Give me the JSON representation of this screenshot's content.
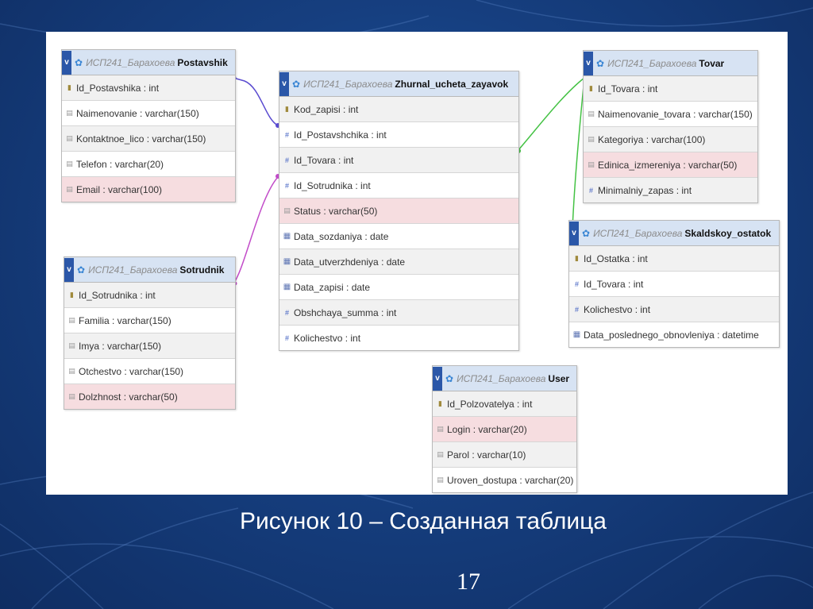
{
  "tables": [
    {
      "db": "ИСП241_Барахоева",
      "name": "Postavshik",
      "fields": [
        {
          "label": "Id_Postavshika : int",
          "icon": "pk"
        },
        {
          "label": "Naimenovanie : varchar(150)",
          "icon": "txt"
        },
        {
          "label": "Kontaktnoe_lico : varchar(150)",
          "icon": "txt"
        },
        {
          "label": "Telefon : varchar(20)",
          "icon": "txt"
        },
        {
          "label": "Email : varchar(100)",
          "icon": "txt"
        }
      ]
    },
    {
      "db": "ИСП241_Барахоева",
      "name": "Zhurnal_ucheta_zayavok",
      "fields": [
        {
          "label": "Kod_zapisi : int",
          "icon": "pk"
        },
        {
          "label": "Id_Postavshchika : int",
          "icon": "int"
        },
        {
          "label": "Id_Tovara : int",
          "icon": "int"
        },
        {
          "label": "Id_Sotrudnika : int",
          "icon": "int"
        },
        {
          "label": "Status : varchar(50)",
          "icon": "txt"
        },
        {
          "label": "Data_sozdaniya : date",
          "icon": "date"
        },
        {
          "label": "Data_utverzhdeniya : date",
          "icon": "date"
        },
        {
          "label": "Data_zapisi : date",
          "icon": "date"
        },
        {
          "label": "Obshchaya_summa : int",
          "icon": "int"
        },
        {
          "label": "Kolichestvo : int",
          "icon": "int"
        }
      ]
    },
    {
      "db": "ИСП241_Барахоева",
      "name": "Tovar",
      "fields": [
        {
          "label": "Id_Tovara : int",
          "icon": "pk"
        },
        {
          "label": "Naimenovanie_tovara : varchar(150)",
          "icon": "txt"
        },
        {
          "label": "Kategoriya : varchar(100)",
          "icon": "txt"
        },
        {
          "label": "Edinica_izmereniya : varchar(50)",
          "icon": "txt"
        },
        {
          "label": "Minimalniy_zapas : int",
          "icon": "int"
        }
      ]
    },
    {
      "db": "ИСП241_Барахоева",
      "name": "Sotrudnik",
      "fields": [
        {
          "label": "Id_Sotrudnika : int",
          "icon": "pk"
        },
        {
          "label": "Familia : varchar(150)",
          "icon": "txt"
        },
        {
          "label": "Imya : varchar(150)",
          "icon": "txt"
        },
        {
          "label": "Otchestvo : varchar(150)",
          "icon": "txt"
        },
        {
          "label": "Dolzhnost : varchar(50)",
          "icon": "txt"
        }
      ]
    },
    {
      "db": "ИСП241_Барахоева",
      "name": "Skaldskoy_ostatok",
      "fields": [
        {
          "label": "Id_Ostatka : int",
          "icon": "pk"
        },
        {
          "label": "Id_Tovara : int",
          "icon": "int"
        },
        {
          "label": "Kolichestvo : int",
          "icon": "int"
        },
        {
          "label": "Data_poslednego_obnovleniya : datetime",
          "icon": "date"
        }
      ]
    },
    {
      "db": "ИСП241_Барахоева",
      "name": "User",
      "fields": [
        {
          "label": "Id_Polzovatelya : int",
          "icon": "pk"
        },
        {
          "label": "Login : varchar(20)",
          "icon": "txt"
        },
        {
          "label": "Parol : varchar(10)",
          "icon": "txt"
        },
        {
          "label": "Uroven_dostupa : varchar(20)",
          "icon": "txt"
        }
      ]
    }
  ],
  "caption": "Рисунок 10 – Созданная таблица",
  "page_number": "17",
  "colors": {
    "background": "#163f80",
    "header": "#d7e3f3",
    "selected_row": "#f6dde0",
    "link_supplier": "#5a4bd0",
    "link_employee": "#c24cc9",
    "link_product": "#44c244"
  }
}
